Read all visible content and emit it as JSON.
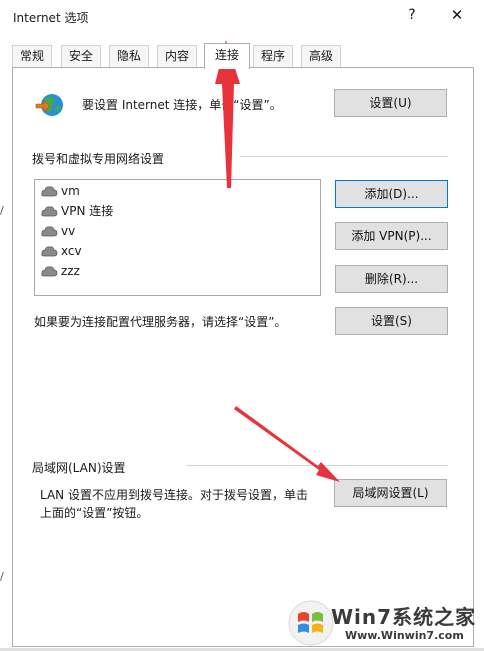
{
  "window": {
    "title": "Internet 选项",
    "help": "?",
    "close": "✕"
  },
  "tabs": [
    "常规",
    "安全",
    "隐私",
    "内容",
    "连接",
    "程序",
    "高级"
  ],
  "setup": {
    "text": "要设置 Internet 连接，单击“设置”。",
    "button": "设置(U)"
  },
  "dialup": {
    "heading": "拨号和虚拟专用网络设置",
    "items": [
      "vm",
      "VPN 连接",
      "vv",
      "xcv",
      "zzz"
    ],
    "add_button": "添加(D)...",
    "add_vpn_button": "添加 VPN(P)...",
    "remove_button": "删除(R)...",
    "proxy_text": "如果要为连接配置代理服务器，请选择“设置”。",
    "settings_button": "设置(S)"
  },
  "lan": {
    "heading": "局域网(LAN)设置",
    "text_line1": "LAN 设置不应用到拨号连接。对于拨号设置，单击",
    "text_line2": "上面的“设置”按钮。",
    "button": "局域网设置(L)"
  },
  "watermark": {
    "text": "Win7系统之家",
    "url": "Www.Winwin7.com"
  },
  "colors": {
    "arrow": "#e8333a",
    "focus_border": "#0078d7",
    "button_bg": "#e1e1e1"
  }
}
